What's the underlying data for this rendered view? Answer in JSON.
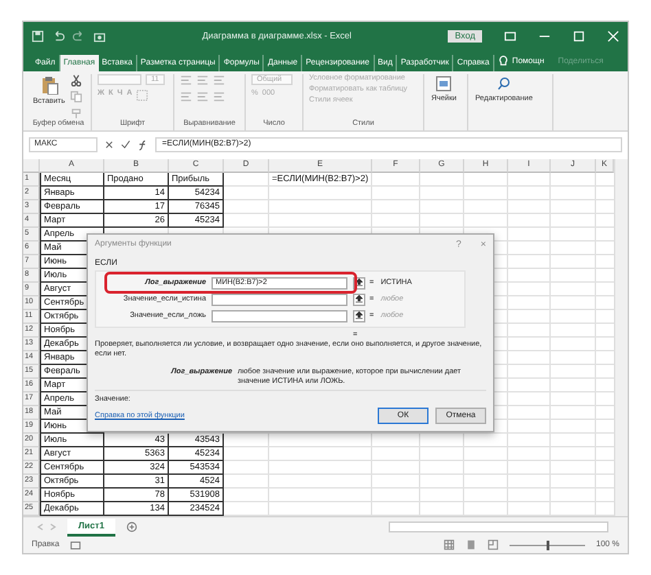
{
  "window": {
    "title": "Диаграмма в диаграмме.xlsx  -  Excel",
    "sign_in": "Вход"
  },
  "ribbon_tabs": [
    {
      "label": "Файл",
      "selected": false
    },
    {
      "label": "Главная",
      "selected": true
    },
    {
      "label": "Вставка",
      "selected": false
    },
    {
      "label": "Разметка страницы",
      "selected": false
    },
    {
      "label": "Формулы",
      "selected": false
    },
    {
      "label": "Данные",
      "selected": false
    },
    {
      "label": "Рецензирование",
      "selected": false
    },
    {
      "label": "Вид",
      "selected": false
    },
    {
      "label": "Разработчик",
      "selected": false
    },
    {
      "label": "Справка",
      "selected": false
    }
  ],
  "tell_me": "Помощн",
  "share": "Поделиться",
  "ribbon_groups": [
    {
      "kind": "clipboard",
      "label": "Буфер обмена",
      "texts": [
        "Вставить"
      ]
    },
    {
      "kind": "font",
      "label": "Шрифт",
      "texts": [
        "11",
        "Ж",
        "К",
        "Ч",
        "А"
      ]
    },
    {
      "kind": "alignment",
      "label": "Выравнивание"
    },
    {
      "kind": "number",
      "label": "Число",
      "texts": [
        "Общий",
        "%",
        "000"
      ]
    },
    {
      "kind": "styles",
      "label": "Стили",
      "texts": [
        "Условное форматирование",
        "Форматировать как таблицу",
        "Стили ячеек"
      ]
    },
    {
      "kind": "cells",
      "texts": [
        "Ячейки"
      ]
    },
    {
      "kind": "editing",
      "texts": [
        "Редактирование"
      ]
    }
  ],
  "formula_bar": {
    "name_box": "МАКС",
    "formula": "=ЕСЛИ(МИН(B2:B7)>2)"
  },
  "grid": {
    "columns": [
      "A",
      "B",
      "C",
      "D",
      "E",
      "F",
      "G",
      "H",
      "I",
      "J",
      "K"
    ],
    "rows": [
      {
        "number": "1",
        "cells": [
          "Месяц",
          "Продано",
          "Прибыль"
        ],
        "spill_text": "=ЕСЛИ(МИН(B2:B7)>2)"
      },
      {
        "number": "2",
        "cells": [
          "Январь",
          "14",
          "54234"
        ]
      },
      {
        "number": "3",
        "cells": [
          "Февраль",
          "17",
          "76345"
        ]
      },
      {
        "number": "4",
        "cells": [
          "Март",
          "26",
          "45234"
        ]
      },
      {
        "number": "5",
        "cells": [
          "Апрель"
        ]
      },
      {
        "number": "6",
        "cells": [
          "Май"
        ]
      },
      {
        "number": "7",
        "cells": [
          "Июнь"
        ]
      },
      {
        "number": "8",
        "cells": [
          "Июль"
        ]
      },
      {
        "number": "9",
        "cells": [
          "Август"
        ]
      },
      {
        "number": "10",
        "cells": [
          "Сентябрь"
        ]
      },
      {
        "number": "11",
        "cells": [
          "Октябрь"
        ]
      },
      {
        "number": "12",
        "cells": [
          "Ноябрь"
        ]
      },
      {
        "number": "13",
        "cells": [
          "Декабрь"
        ]
      },
      {
        "number": "14",
        "cells": [
          "Январь"
        ]
      },
      {
        "number": "15",
        "cells": [
          "Февраль"
        ]
      },
      {
        "number": "16",
        "cells": [
          "Март"
        ]
      },
      {
        "number": "17",
        "cells": [
          "Апрель"
        ]
      },
      {
        "number": "18",
        "cells": [
          "Май"
        ]
      },
      {
        "number": "19",
        "cells": [
          "Июнь"
        ]
      },
      {
        "number": "20",
        "cells": [
          "Июль",
          "43",
          "43543"
        ]
      },
      {
        "number": "21",
        "cells": [
          "Август",
          "5363",
          "45234"
        ]
      },
      {
        "number": "22",
        "cells": [
          "Сентябрь",
          "324",
          "543534"
        ]
      },
      {
        "number": "23",
        "cells": [
          "Октябрь",
          "31",
          "4524"
        ]
      },
      {
        "number": "24",
        "cells": [
          "Ноябрь",
          "78",
          "531908"
        ]
      },
      {
        "number": "25",
        "cells": [
          "Декабрь",
          "134",
          "234524"
        ]
      }
    ]
  },
  "sheet_tabs": [
    {
      "label": "Лист1",
      "selected": true
    }
  ],
  "status_bar": {
    "mode": "Правка",
    "zoom": "100 %",
    "zoom_slider": {
      "level": 0.5
    }
  },
  "dialog": {
    "title": "Аргументы функции",
    "help": "?",
    "close": "×",
    "function": "ЕСЛИ",
    "arguments": [
      {
        "label": "Лог_выражение",
        "value": "МИН(B2:B7)>2",
        "equals": "=",
        "result": "ИСТИНА",
        "highlighted": true,
        "result_muted": false
      },
      {
        "label": "Значение_если_истина",
        "equals": "=",
        "result": "любое",
        "highlighted": false,
        "result_muted": true
      },
      {
        "label": "Значение_если_ложь",
        "equals": "=",
        "result": "любое",
        "highlighted": false,
        "result_muted": true
      }
    ],
    "overall_result": "=",
    "description": "Проверяет, выполняется ли условие, и возвращает одно значение, если оно выполняется, и другое значение, если нет.",
    "argument_help": {
      "name": "Лог_выражение",
      "text": "любое значение или выражение, которое при вычислении дает значение ИСТИНА или ЛОЖЬ."
    },
    "value_label": "Значение:",
    "help_link": "Справка по этой функции",
    "buttons": [
      {
        "label": "ОК",
        "default": true
      },
      {
        "label": "Отмена",
        "default": false
      }
    ]
  }
}
